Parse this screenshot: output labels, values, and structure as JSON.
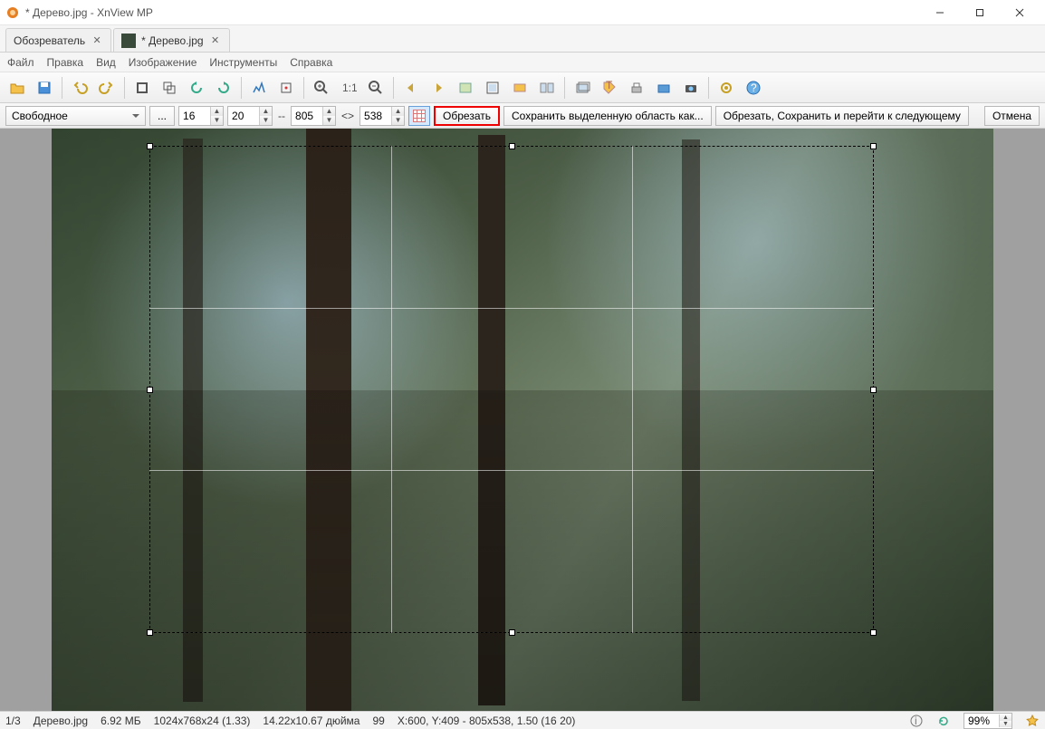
{
  "window": {
    "title": "* Дерево.jpg - XnView MP"
  },
  "tabs": [
    {
      "label": "Обозреватель"
    },
    {
      "label": "* Дерево.jpg"
    }
  ],
  "menu": [
    "Файл",
    "Правка",
    "Вид",
    "Изображение",
    "Инструменты",
    "Справка"
  ],
  "crop": {
    "mode": "Свободное",
    "more": "...",
    "x": "16",
    "y": "20",
    "dash": "--",
    "w": "805",
    "h": "538",
    "swap": "<>",
    "crop_btn": "Обрезать",
    "save_sel": "Сохранить выделенную область как...",
    "crop_save_next": "Обрезать, Сохранить и перейти к следующему",
    "cancel": "Отмена"
  },
  "status": {
    "index": "1/3",
    "filename": "Дерево.jpg",
    "size": "6.92 МБ",
    "dims": "1024x768x24 (1.33)",
    "print": "14.22x10.67 дюйма",
    "dpi": "99",
    "coords": "X:600, Y:409 - 805x538, 1.50 (16 20)",
    "zoom": "99%"
  }
}
